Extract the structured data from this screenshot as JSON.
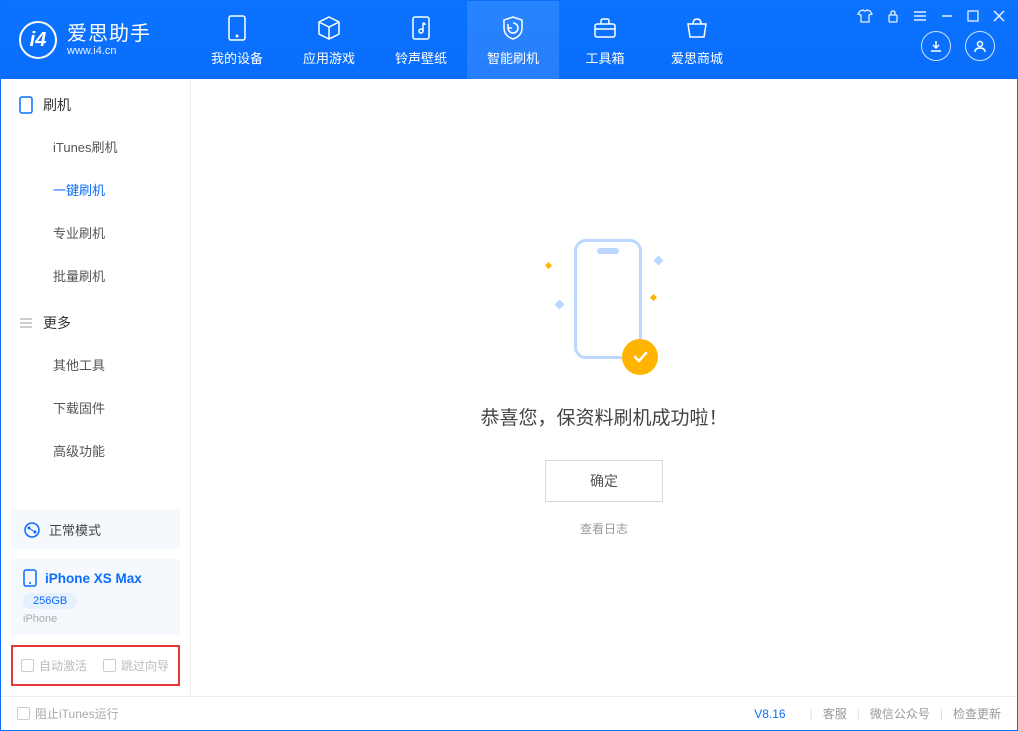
{
  "app": {
    "name_cn": "爱思助手",
    "name_en": "www.i4.cn"
  },
  "tabs": {
    "device": "我的设备",
    "apps": "应用游戏",
    "ringtone": "铃声壁纸",
    "flash": "智能刷机",
    "toolbox": "工具箱",
    "store": "爱思商城"
  },
  "nav": {
    "group_flash": "刷机",
    "itunes_flash": "iTunes刷机",
    "one_click": "一键刷机",
    "pro_flash": "专业刷机",
    "batch_flash": "批量刷机",
    "group_more": "更多",
    "other_tools": "其他工具",
    "download_fw": "下载固件",
    "advanced": "高级功能"
  },
  "mode": {
    "label": "正常模式"
  },
  "device": {
    "name": "iPhone XS Max",
    "storage": "256GB",
    "type": "iPhone"
  },
  "checks": {
    "auto_activate": "自动激活",
    "skip_guide": "跳过向导"
  },
  "result": {
    "message": "恭喜您，保资料刷机成功啦！",
    "ok": "确定",
    "view_log": "查看日志"
  },
  "status": {
    "block_itunes": "阻止iTunes运行",
    "version": "V8.16",
    "support": "客服",
    "wechat": "微信公众号",
    "update": "检查更新"
  }
}
